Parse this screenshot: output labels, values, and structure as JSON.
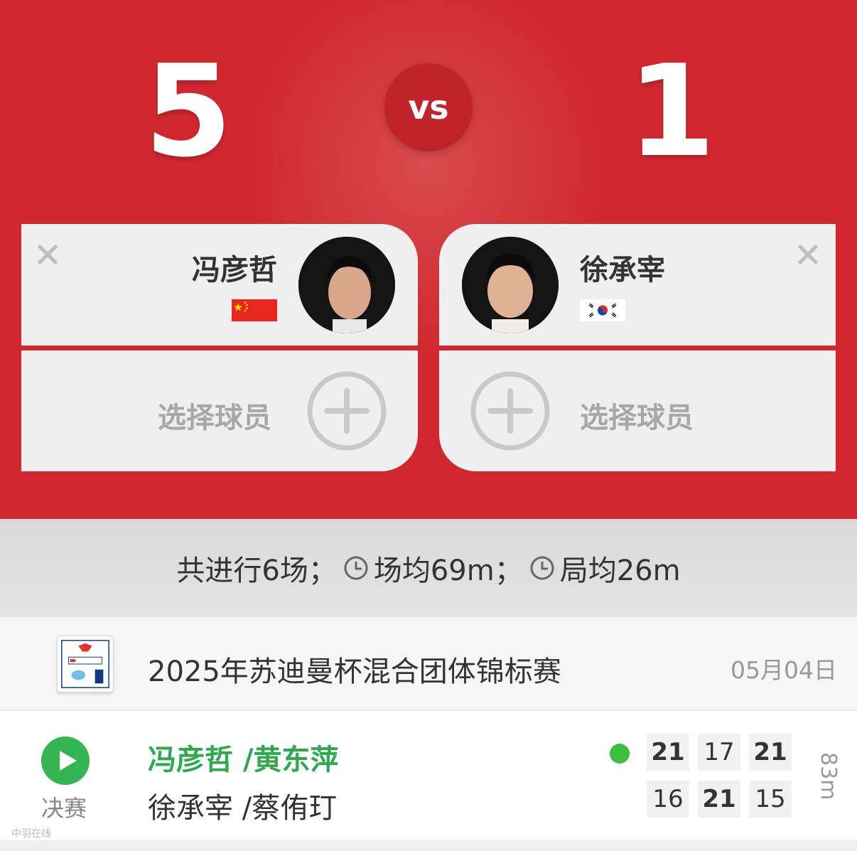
{
  "header": {
    "left_score": "5",
    "vs_label": "vs",
    "right_score": "1",
    "accent_color": "#d0282e"
  },
  "player_left": {
    "name": "冯彦哲",
    "flag": "china-flag",
    "select_label": "选择球员"
  },
  "player_right": {
    "name": "徐承宰",
    "flag": "korea-flag",
    "select_label": "选择球员"
  },
  "stats": {
    "total": "共进行6场；",
    "avg_match": "场均69m；",
    "avg_game": "局均26m"
  },
  "tournament": {
    "title": "2025年苏迪曼杯混合团体锦标赛",
    "date": "05月04日"
  },
  "match": {
    "round": "决赛",
    "pair1_a": "冯彦哲",
    "pair1_b": "/黄东萍",
    "pair2_a": "徐承宰",
    "pair2_b": "/蔡侑玎",
    "scores_top": [
      "21",
      "17",
      "21"
    ],
    "scores_bottom": [
      "16",
      "21",
      "15"
    ],
    "duration": "83m",
    "winner_color": "#2fa84f"
  },
  "watermark": "中羽在线"
}
